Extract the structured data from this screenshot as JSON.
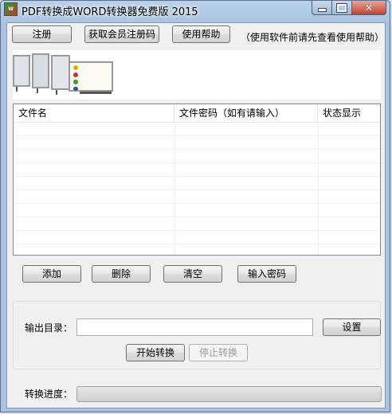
{
  "window": {
    "title": "PDF转换成WORD转换器免费版 2015",
    "icon_name": "pdf-to-word-app-icon"
  },
  "toolbar": {
    "register_label": "注册",
    "get_code_label": "获取会员注册码",
    "help_label": "使用帮助",
    "help_note": "（使用软件前请先查看使用帮助）"
  },
  "file_table": {
    "columns": [
      "文件名",
      "文件密码（如有请输入）",
      "状态显示"
    ],
    "rows": []
  },
  "actions": {
    "add_label": "添加",
    "delete_label": "删除",
    "clear_label": "清空",
    "password_label": "输入密码"
  },
  "output": {
    "dir_label": "输出目录：",
    "dir_value": "",
    "settings_label": "设置",
    "start_label": "开始转换",
    "stop_label": "停止转换"
  },
  "progress": {
    "label": "转换进度：",
    "fraction": 0
  }
}
